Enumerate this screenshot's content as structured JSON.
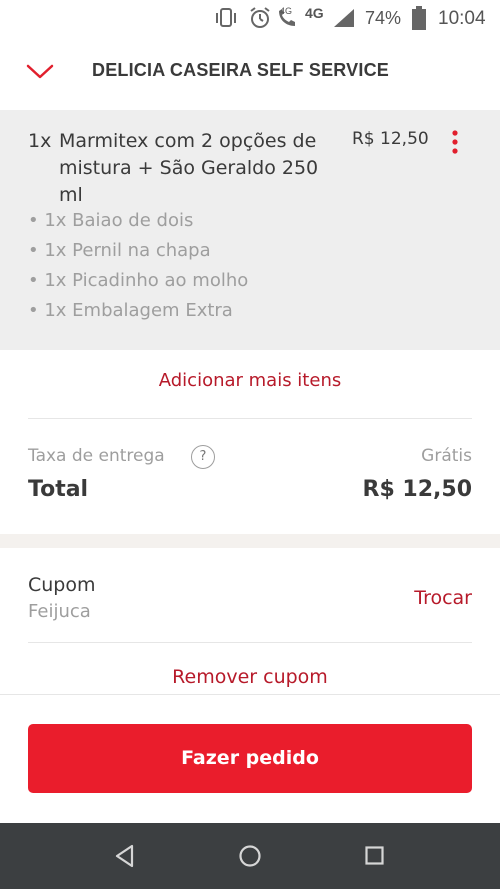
{
  "status_bar": {
    "network_small": "4G",
    "network": "4G",
    "battery_percent": "74%",
    "time": "10:04"
  },
  "header": {
    "title": "DELICIA CASEIRA SELF SERVICE",
    "back_icon": "chevron-down-icon"
  },
  "cart": {
    "item": {
      "quantity": "1x",
      "name_line1": "Marmitex com 2 opções de",
      "name_line2": "mistura + São Geraldo 250",
      "name_line3": "ml",
      "price": "R$ 12,50",
      "options": [
        "• 1x Baiao de dois",
        "• 1x Pernil na chapa",
        "• 1x Picadinho ao molho",
        "• 1x Embalagem Extra"
      ]
    },
    "add_more_label": "Adicionar mais itens"
  },
  "summary": {
    "delivery_fee_label": "Taxa de entrega",
    "delivery_fee_help": "?",
    "delivery_fee_value": "Grátis",
    "total_label": "Total",
    "total_value": "R$ 12,50"
  },
  "coupon": {
    "label": "Cupom",
    "code": "Feijuca",
    "change_label": "Trocar",
    "remove_label": "Remover cupom"
  },
  "actions": {
    "place_order_label": "Fazer pedido"
  },
  "colors": {
    "accent": "#ea1d2c",
    "link": "#b71a2a"
  }
}
